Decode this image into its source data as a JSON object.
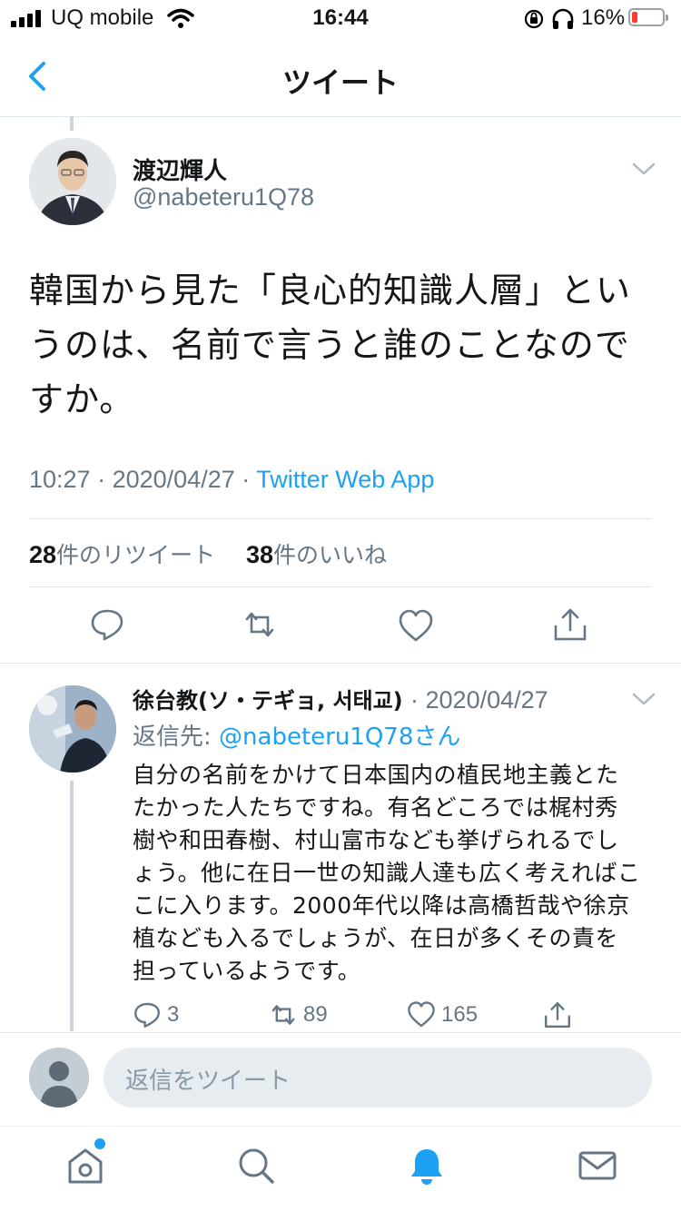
{
  "status_bar": {
    "carrier": "UQ mobile",
    "time": "16:44",
    "battery_percent": "16%",
    "battery_level": 0.16
  },
  "nav": {
    "title": "ツイート"
  },
  "tweet": {
    "author_name": "渡辺輝人",
    "author_handle": "@nabeteru1Q78",
    "text": "韓国から見た「良心的知識人層」というのは、名前で言うと誰のことなのですか。",
    "time": "10:27",
    "date": "2020/04/27",
    "source": "Twitter Web App",
    "retweet_count": "28",
    "retweet_label": "件のリツイート",
    "like_count": "38",
    "like_label": "件のいいね"
  },
  "reply": {
    "author_name": "徐台教(ソ・テギョ, 서태교)",
    "date": "2020/04/27",
    "reply_to_prefix": "返信先: ",
    "reply_to": "@nabeteru1Q78さん",
    "text": "自分の名前をかけて日本国内の植民地主義とたたかった人たちですね。有名どころでは梶村秀樹や和田春樹、村山富市なども挙げられるでしょう。他に在日一世の知識人達も広く考えればここに入ります。2000年代以降は高橋哲哉や徐京植なども入るでしょうが、在日が多くその責を担っているようです。",
    "replies": "3",
    "retweets": "89",
    "likes": "165"
  },
  "compose": {
    "placeholder": "返信をツイート"
  },
  "colors": {
    "accent": "#1da1f2",
    "secondary_text": "#657786",
    "divider": "#e1e8ed"
  }
}
